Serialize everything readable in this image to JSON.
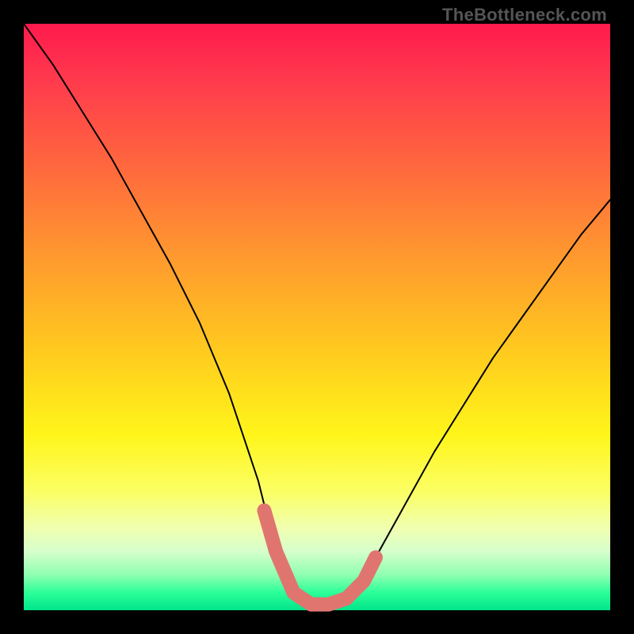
{
  "watermark": "TheBottleneck.com",
  "chart_data": {
    "type": "line",
    "title": "",
    "xlabel": "",
    "ylabel": "",
    "xlim": [
      0,
      100
    ],
    "ylim": [
      0,
      100
    ],
    "grid": false,
    "legend": false,
    "series": [
      {
        "name": "bottleneck-curve",
        "color": "#000000",
        "x": [
          0,
          5,
          10,
          15,
          20,
          25,
          30,
          35,
          40,
          42,
          45,
          48,
          50,
          52,
          55,
          58,
          60,
          65,
          70,
          75,
          80,
          85,
          90,
          95,
          100
        ],
        "values": [
          100,
          93,
          85,
          77,
          68,
          59,
          49,
          37,
          22,
          14,
          6,
          2,
          1,
          1,
          2,
          4,
          9,
          18,
          27,
          35,
          43,
          50,
          57,
          64,
          70
        ]
      }
    ],
    "markers": [
      {
        "name": "trough-highlight",
        "color": "#e07570",
        "points": [
          {
            "x": 41,
            "y": 17
          },
          {
            "x": 43,
            "y": 10
          },
          {
            "x": 46,
            "y": 3
          },
          {
            "x": 49,
            "y": 1
          },
          {
            "x": 52,
            "y": 1
          },
          {
            "x": 55,
            "y": 2
          },
          {
            "x": 58,
            "y": 5
          },
          {
            "x": 60,
            "y": 9
          }
        ]
      }
    ],
    "background_gradient": {
      "top": "#ff1a4d",
      "bottom": "#00e58a"
    }
  }
}
